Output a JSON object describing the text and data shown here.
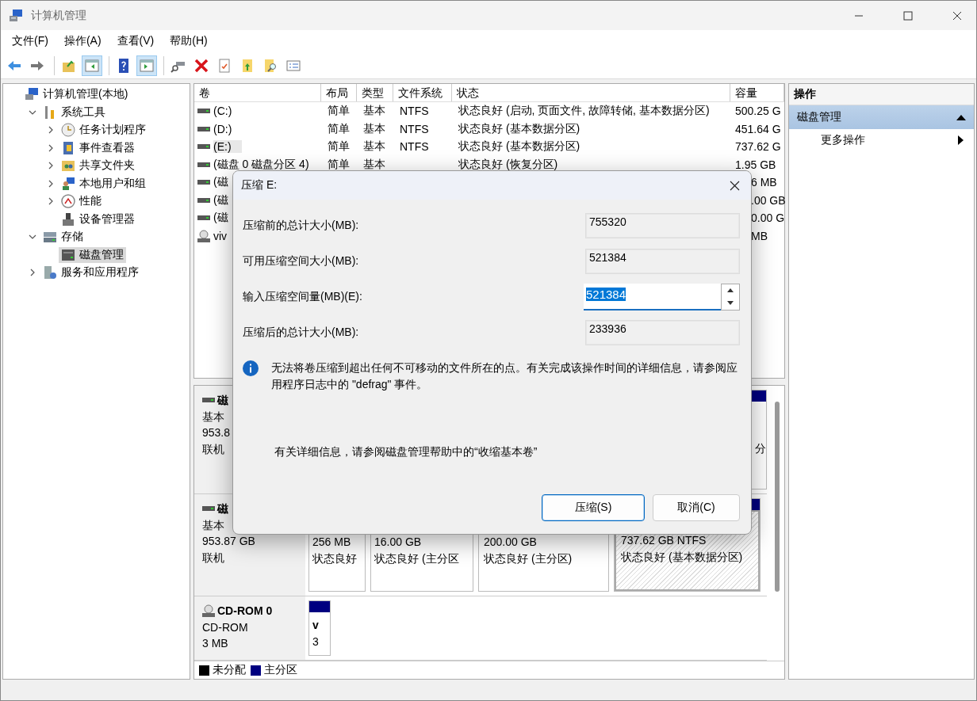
{
  "window": {
    "title": "计算机管理"
  },
  "menu": [
    "文件(F)",
    "操作(A)",
    "查看(V)",
    "帮助(H)"
  ],
  "toolbar": [
    [
      {
        "kind": "back",
        "pressed": false
      },
      {
        "kind": "forward",
        "pressed": false
      }
    ],
    [
      {
        "kind": "up",
        "pressed": false
      },
      {
        "kind": "tree",
        "pressed": true
      }
    ],
    [
      {
        "kind": "help",
        "pressed": false
      },
      {
        "kind": "pane",
        "pressed": true
      }
    ],
    [
      {
        "kind": "connect",
        "pressed": false
      },
      {
        "kind": "delete",
        "pressed": false
      },
      {
        "kind": "properties",
        "pressed": false
      },
      {
        "kind": "export",
        "pressed": false
      },
      {
        "kind": "find",
        "pressed": false
      },
      {
        "kind": "list",
        "pressed": false
      }
    ]
  ],
  "tree": [
    {
      "label": "计算机管理(本地)",
      "kind": "computer",
      "selected": false,
      "children": [
        {
          "label": "系统工具",
          "kind": "tools",
          "selected": false,
          "expanded": true,
          "children": [
            {
              "label": "任务计划程序",
              "kind": "clock",
              "selected": false,
              "expanded": false
            },
            {
              "label": "事件查看器",
              "kind": "log",
              "selected": false,
              "expanded": false
            },
            {
              "label": "共享文件夹",
              "kind": "share",
              "selected": false,
              "expanded": false
            },
            {
              "label": "本地用户和组",
              "kind": "users",
              "selected": false,
              "expanded": false
            },
            {
              "label": "性能",
              "kind": "perf",
              "selected": false,
              "expanded": false
            },
            {
              "label": "设备管理器",
              "kind": "device",
              "selected": false
            }
          ]
        },
        {
          "label": "存储",
          "kind": "storage",
          "selected": false,
          "expanded": true,
          "children": [
            {
              "label": "磁盘管理",
              "kind": "disk",
              "selected": true
            }
          ]
        },
        {
          "label": "服务和应用程序",
          "kind": "services",
          "selected": false,
          "expanded": false
        }
      ]
    }
  ],
  "table": {
    "columns": [
      "卷",
      "布局",
      "类型",
      "文件系统",
      "状态",
      "容量"
    ],
    "rows": [
      {
        "kind": "drive",
        "volume": "(C:)",
        "layout": "简单",
        "type": "基本",
        "filesystem": "NTFS",
        "status": "状态良好 (启动, 页面文件, 故障转储, 基本数据分区)",
        "capacity": "500.25 G",
        "selected": false
      },
      {
        "kind": "drive",
        "volume": "(D:)",
        "layout": "简单",
        "type": "基本",
        "filesystem": "NTFS",
        "status": "状态良好 (基本数据分区)",
        "capacity": "451.64 G",
        "selected": false
      },
      {
        "kind": "drive",
        "volume": "(E:)",
        "layout": "简单",
        "type": "基本",
        "filesystem": "NTFS",
        "status": "状态良好 (基本数据分区)",
        "capacity": "737.62 G",
        "selected": true
      },
      {
        "kind": "drive",
        "volume": "(磁盘 0 磁盘分区 4)",
        "layout": "简单",
        "type": "基本",
        "status": "状态良好 (恢复分区)",
        "capacity": "1.95 GB",
        "selected": false
      },
      {
        "kind": "drive",
        "volume": "(磁",
        "capacity": "6 MB",
        "selected": false
      },
      {
        "kind": "drive",
        "volume": "(磁",
        "capacity": ".00 GB",
        "selected": false
      },
      {
        "kind": "drive",
        "volume": "(磁",
        "capacity": "0.00 G",
        "selected": false
      },
      {
        "kind": "disc",
        "volume": "viv",
        "capacity": "MB",
        "selected": false
      }
    ]
  },
  "disks": [
    {
      "kind": "drive",
      "name": "磁",
      "type": "基本",
      "size": "953.8",
      "status": "联机",
      "partitions": [
        {
          "lines": [
            "分"
          ],
          "selected": false,
          "color": "#000080"
        }
      ]
    },
    {
      "kind": "drive",
      "name": "磁",
      "type": "基本",
      "size": "953.87 GB",
      "status": "联机",
      "partitions": [
        {
          "lines": [
            "256 MB",
            "状态良好"
          ],
          "selected": false
        },
        {
          "lines": [
            "16.00 GB",
            "状态良好 (主分区"
          ],
          "selected": false
        },
        {
          "lines": [
            "200.00 GB",
            "状态良好 (主分区)"
          ],
          "selected": false
        },
        {
          "lines": [
            "737.62 GB NTFS",
            "状态良好 (基本数据分区)"
          ],
          "selected": true,
          "color": "#000080"
        }
      ]
    },
    {
      "kind": "disc",
      "name": "CD-ROM 0",
      "type": "CD-ROM",
      "size": "3 MB",
      "partitions": [
        {
          "lines": [
            "v",
            "3"
          ],
          "selected": false,
          "color": "#000080"
        }
      ]
    }
  ],
  "legend": [
    {
      "label": "未分配",
      "color": "#000000"
    },
    {
      "label": "主分区",
      "color": "#000080"
    }
  ],
  "actions": {
    "title": "操作",
    "section": {
      "label": "磁盘管理",
      "expanded": true
    },
    "items": [
      "更多操作"
    ]
  },
  "dialog": {
    "title": "压缩 E:",
    "fields": [
      {
        "label": "压缩前的总计大小(MB):",
        "value": "755320",
        "kind": "readonly"
      },
      {
        "label": "可用压缩空间大小(MB):",
        "value": "521384",
        "kind": "readonly"
      },
      {
        "label": "输入压缩空间量(MB)(E):",
        "value": "521384",
        "kind": "spin",
        "selected": true
      },
      {
        "label": "压缩后的总计大小(MB):",
        "value": "233936",
        "kind": "readonly"
      }
    ],
    "info": "无法将卷压缩到超出任何不可移动的文件所在的点。有关完成该操作时间的详细信息，请参阅应用程序日志中的 \"defrag\" 事件。",
    "note": "有关详细信息，请参阅磁盘管理帮助中的“收缩基本卷”",
    "buttons": [
      {
        "label": "压缩(S)",
        "default": true
      },
      {
        "label": "取消(C)",
        "default": false
      }
    ]
  }
}
